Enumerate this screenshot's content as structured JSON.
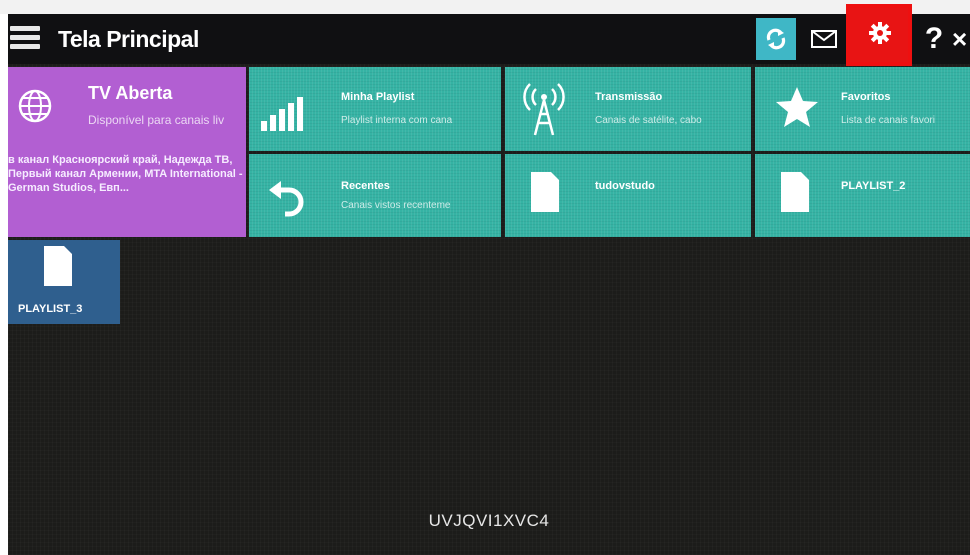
{
  "header": {
    "title": "Tela Principal",
    "icons": {
      "menu": "hamburger-icon",
      "refresh": "refresh-icon",
      "mail": "mail-icon",
      "settings": "gear-icon",
      "help": "help-icon",
      "close": "close-icon"
    },
    "help_label": "?",
    "close_label": "×",
    "accent_color": "#3fb7c6",
    "highlight_color": "#e81414"
  },
  "tiles": {
    "tv_aberta": {
      "title": "TV Aberta",
      "subtitle": "Disponível para canais liv",
      "channels": "в канал Красноярский край, Надежда ТВ, Первый канал Армении, MTA International - German Studios, Евп...",
      "icon": "globe-icon",
      "color": "#b25fd2"
    },
    "minha_playlist": {
      "title": "Minha Playlist",
      "subtitle": "Playlist interna com cana",
      "icon": "signal-bars-icon"
    },
    "transmissao": {
      "title": "Transmissão",
      "subtitle": "Canais de satélite, cabo",
      "icon": "antenna-icon"
    },
    "favoritos": {
      "title": "Favoritos",
      "subtitle": "Lista de canais favori",
      "icon": "star-icon"
    },
    "recentes": {
      "title": "Recentes",
      "subtitle": "Canais vistos recenteme",
      "icon": "back-arrow-icon"
    },
    "tudovstudo": {
      "title": "tudovstudo",
      "icon": "file-icon"
    },
    "playlist_2": {
      "title": "PLAYLIST_2",
      "icon": "file-icon"
    },
    "playlist_3": {
      "title": "PLAYLIST_3",
      "icon": "file-icon",
      "color": "#2f5f8e"
    },
    "teal_color": "#35b3a4"
  },
  "footer": {
    "code": "UVJQVI1XVC4"
  }
}
